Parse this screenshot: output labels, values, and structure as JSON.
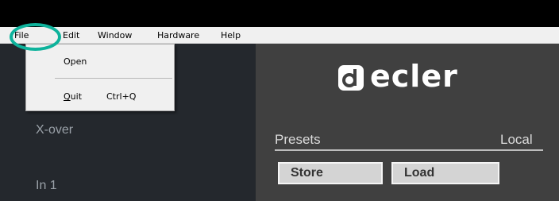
{
  "menubar": {
    "items": [
      {
        "label": "File"
      },
      {
        "label": "Edit"
      },
      {
        "label": "Window"
      },
      {
        "label": "Hardware"
      },
      {
        "label": "Help"
      }
    ]
  },
  "file_menu": {
    "open_label": "Open",
    "quit_label": "Quit",
    "quit_shortcut": "Ctrl+Q"
  },
  "left_panel": {
    "labels": [
      "X-over",
      "In 1"
    ]
  },
  "brand": {
    "name": "ecler",
    "icon": "ecler-logo-icon"
  },
  "presets": {
    "title": "Presets",
    "location": "Local",
    "store_label": "Store",
    "load_label": "Load"
  },
  "colors": {
    "highlight": "#0eb39c",
    "left_panel_bg": "#24282d",
    "right_panel_bg": "#404040"
  }
}
